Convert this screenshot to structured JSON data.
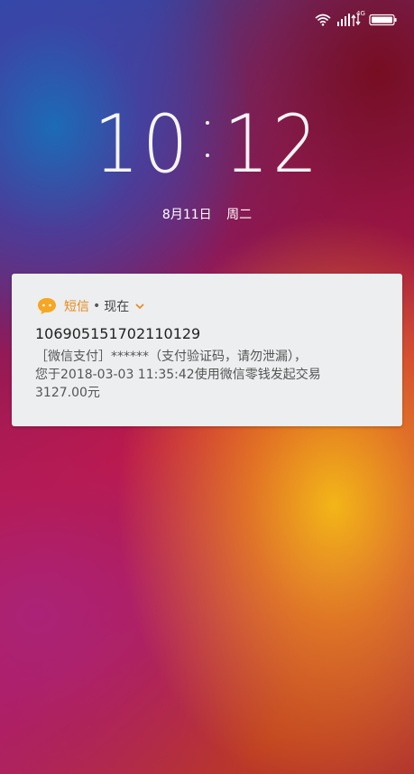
{
  "status_bar": {
    "network_type": "4G",
    "icons": [
      "wifi-icon",
      "signal-icon",
      "battery-icon"
    ]
  },
  "lock_screen": {
    "clock_hours": "10",
    "clock_minutes": "12",
    "date": "8月11日",
    "weekday": "周二"
  },
  "notification": {
    "app_name": "短信",
    "separator": "•",
    "time": "现在",
    "sender": "106905151702110129",
    "body_lines": [
      "［微信支付］******（支付验证码，请勿泄漏），",
      "您于2018-03-03  11:35:42使用微信零钱发起交易",
      "3127.00元"
    ],
    "accent_color": "#f5a623"
  }
}
